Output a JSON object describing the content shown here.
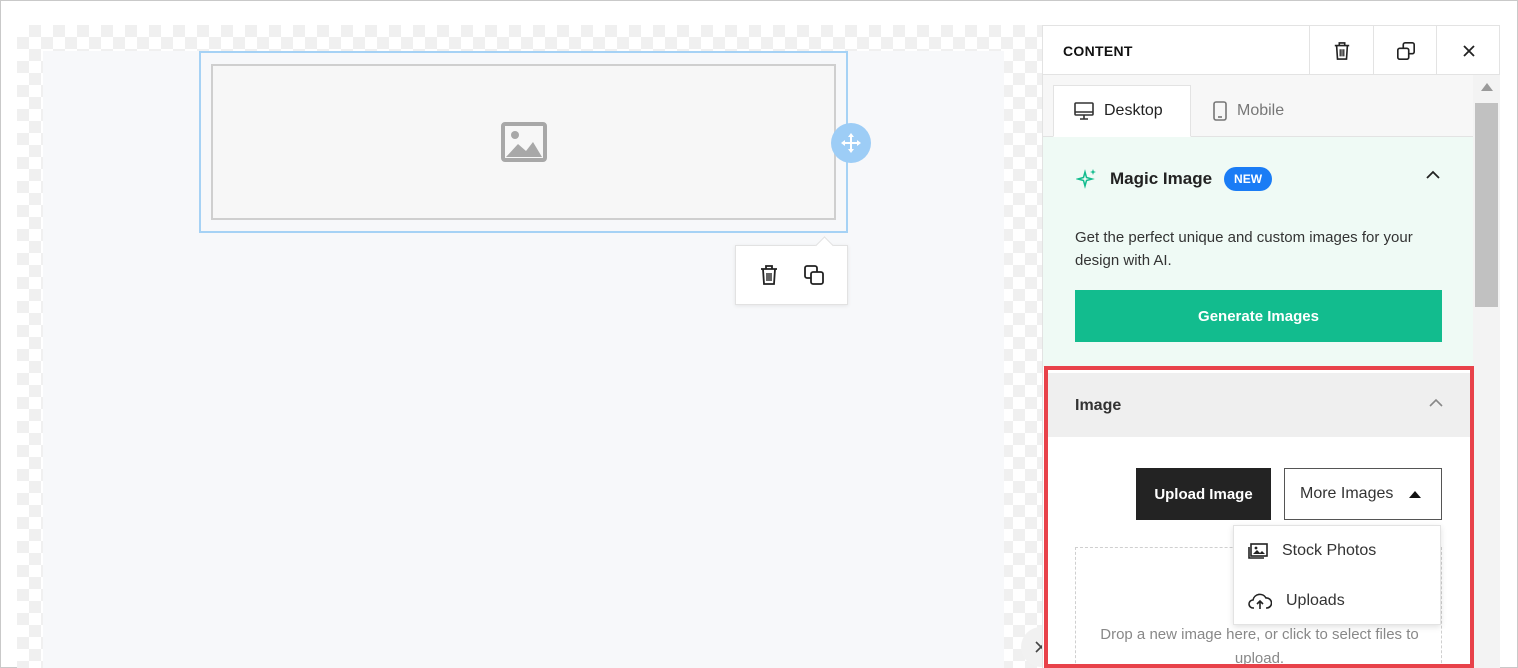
{
  "panel": {
    "title": "CONTENT",
    "header_actions": [
      "trash-icon",
      "duplicate-icon",
      "close-icon"
    ],
    "tabs": [
      {
        "label": "Desktop",
        "icon": "desktop-icon",
        "active": true
      },
      {
        "label": "Mobile",
        "icon": "mobile-icon",
        "active": false
      }
    ]
  },
  "magic_image": {
    "title": "Magic Image",
    "badge": "NEW",
    "description": "Get the perfect unique and custom images for your design with AI.",
    "button": "Generate Images",
    "accent": "#12bc8e",
    "badge_color": "#1a7cf5"
  },
  "image_section": {
    "title": "Image",
    "upload_button": "Upload Image",
    "more_button": "More Images",
    "drop_text": "Drop a new image here, or click to select files to upload.",
    "dropdown": [
      {
        "label": "Stock Photos",
        "icon": "photo-icon"
      },
      {
        "label": "Uploads",
        "icon": "cloud-upload-icon"
      }
    ],
    "highlight_color": "#e8424a"
  },
  "canvas": {
    "selection_color": "#a6d2f5",
    "toolbar": [
      "trash-icon",
      "duplicate-icon"
    ]
  }
}
